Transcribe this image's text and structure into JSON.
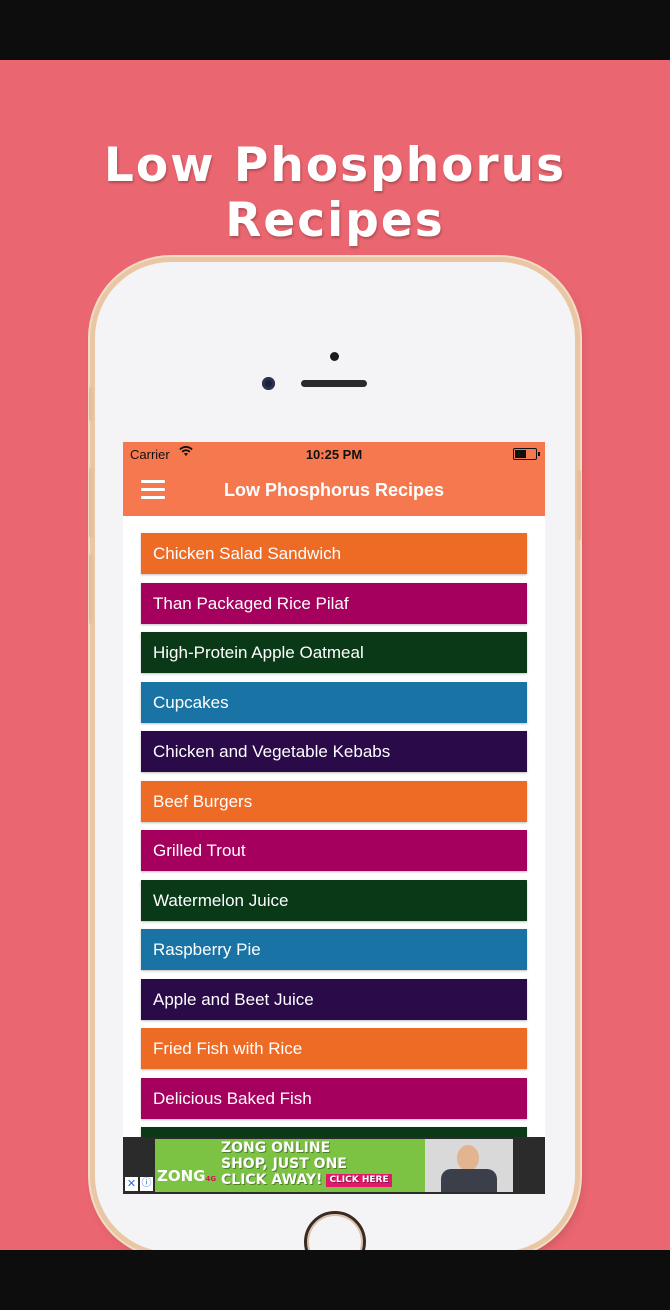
{
  "promo_title": "Low Phosphorus Recipes",
  "status_bar": {
    "carrier": "Carrier",
    "time": "10:25 PM"
  },
  "app_bar": {
    "title": "Low Phosphorus Recipes",
    "menu_icon": "hamburger-menu-icon"
  },
  "recipes": [
    {
      "label": "Chicken Salad Sandwich",
      "color": "#ee6b25"
    },
    {
      "label": "Than Packaged Rice Pilaf",
      "color": "#a5005d"
    },
    {
      "label": "High-Protein Apple Oatmeal",
      "color": "#093916"
    },
    {
      "label": "Cupcakes",
      "color": "#1a73a5"
    },
    {
      "label": "Chicken and Vegetable Kebabs",
      "color": "#2a0a48"
    },
    {
      "label": "Beef Burgers",
      "color": "#ee6b25"
    },
    {
      "label": "Grilled Trout",
      "color": "#a5005d"
    },
    {
      "label": "Watermelon Juice",
      "color": "#093916"
    },
    {
      "label": "Raspberry Pie",
      "color": "#1a73a5"
    },
    {
      "label": "Apple and Beet Juice",
      "color": "#2a0a48"
    },
    {
      "label": "Fried Fish with Rice",
      "color": "#ee6b25"
    },
    {
      "label": "Delicious Baked Fish",
      "color": "#a5005d"
    },
    {
      "label": "",
      "color": "#093916"
    }
  ],
  "ad": {
    "brand": "ZONG",
    "brand_suffix": "4G",
    "line1": "ZONG ONLINE",
    "line2": "SHOP, JUST ONE",
    "line3": "CLICK AWAY!",
    "cta": "CLICK HERE"
  }
}
